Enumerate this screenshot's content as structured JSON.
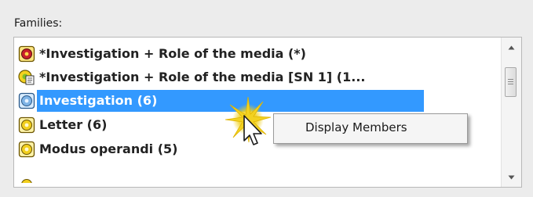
{
  "families": {
    "label": "Families:",
    "items": [
      {
        "label": "*Investigation + Role of the media (*)",
        "icon": "family-icon-red",
        "selected": false
      },
      {
        "label": "*Investigation + Role of the media [SN 1] (1...",
        "icon": "family-icon-notes",
        "selected": false
      },
      {
        "label": "Investigation (6)",
        "icon": "family-icon-blue",
        "selected": true
      },
      {
        "label": "Letter (6)",
        "icon": "family-icon-yellow",
        "selected": false
      },
      {
        "label": "Modus operandi (5)",
        "icon": "family-icon-yellow",
        "selected": false
      }
    ]
  },
  "context_menu": {
    "items": [
      {
        "label": "Display Members"
      }
    ]
  },
  "colors": {
    "selection": "#3399ff",
    "burst": "#f2d220",
    "background": "#ececec"
  }
}
